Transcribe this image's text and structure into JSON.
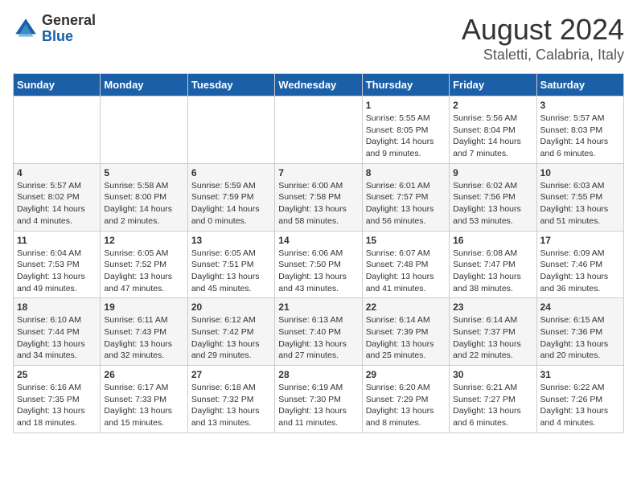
{
  "header": {
    "logo_general": "General",
    "logo_blue": "Blue",
    "month": "August 2024",
    "location": "Staletti, Calabria, Italy"
  },
  "days_of_week": [
    "Sunday",
    "Monday",
    "Tuesday",
    "Wednesday",
    "Thursday",
    "Friday",
    "Saturday"
  ],
  "weeks": [
    [
      {
        "day": "",
        "info": ""
      },
      {
        "day": "",
        "info": ""
      },
      {
        "day": "",
        "info": ""
      },
      {
        "day": "",
        "info": ""
      },
      {
        "day": "1",
        "info": "Sunrise: 5:55 AM\nSunset: 8:05 PM\nDaylight: 14 hours\nand 9 minutes."
      },
      {
        "day": "2",
        "info": "Sunrise: 5:56 AM\nSunset: 8:04 PM\nDaylight: 14 hours\nand 7 minutes."
      },
      {
        "day": "3",
        "info": "Sunrise: 5:57 AM\nSunset: 8:03 PM\nDaylight: 14 hours\nand 6 minutes."
      }
    ],
    [
      {
        "day": "4",
        "info": "Sunrise: 5:57 AM\nSunset: 8:02 PM\nDaylight: 14 hours\nand 4 minutes."
      },
      {
        "day": "5",
        "info": "Sunrise: 5:58 AM\nSunset: 8:00 PM\nDaylight: 14 hours\nand 2 minutes."
      },
      {
        "day": "6",
        "info": "Sunrise: 5:59 AM\nSunset: 7:59 PM\nDaylight: 14 hours\nand 0 minutes."
      },
      {
        "day": "7",
        "info": "Sunrise: 6:00 AM\nSunset: 7:58 PM\nDaylight: 13 hours\nand 58 minutes."
      },
      {
        "day": "8",
        "info": "Sunrise: 6:01 AM\nSunset: 7:57 PM\nDaylight: 13 hours\nand 56 minutes."
      },
      {
        "day": "9",
        "info": "Sunrise: 6:02 AM\nSunset: 7:56 PM\nDaylight: 13 hours\nand 53 minutes."
      },
      {
        "day": "10",
        "info": "Sunrise: 6:03 AM\nSunset: 7:55 PM\nDaylight: 13 hours\nand 51 minutes."
      }
    ],
    [
      {
        "day": "11",
        "info": "Sunrise: 6:04 AM\nSunset: 7:53 PM\nDaylight: 13 hours\nand 49 minutes."
      },
      {
        "day": "12",
        "info": "Sunrise: 6:05 AM\nSunset: 7:52 PM\nDaylight: 13 hours\nand 47 minutes."
      },
      {
        "day": "13",
        "info": "Sunrise: 6:05 AM\nSunset: 7:51 PM\nDaylight: 13 hours\nand 45 minutes."
      },
      {
        "day": "14",
        "info": "Sunrise: 6:06 AM\nSunset: 7:50 PM\nDaylight: 13 hours\nand 43 minutes."
      },
      {
        "day": "15",
        "info": "Sunrise: 6:07 AM\nSunset: 7:48 PM\nDaylight: 13 hours\nand 41 minutes."
      },
      {
        "day": "16",
        "info": "Sunrise: 6:08 AM\nSunset: 7:47 PM\nDaylight: 13 hours\nand 38 minutes."
      },
      {
        "day": "17",
        "info": "Sunrise: 6:09 AM\nSunset: 7:46 PM\nDaylight: 13 hours\nand 36 minutes."
      }
    ],
    [
      {
        "day": "18",
        "info": "Sunrise: 6:10 AM\nSunset: 7:44 PM\nDaylight: 13 hours\nand 34 minutes."
      },
      {
        "day": "19",
        "info": "Sunrise: 6:11 AM\nSunset: 7:43 PM\nDaylight: 13 hours\nand 32 minutes."
      },
      {
        "day": "20",
        "info": "Sunrise: 6:12 AM\nSunset: 7:42 PM\nDaylight: 13 hours\nand 29 minutes."
      },
      {
        "day": "21",
        "info": "Sunrise: 6:13 AM\nSunset: 7:40 PM\nDaylight: 13 hours\nand 27 minutes."
      },
      {
        "day": "22",
        "info": "Sunrise: 6:14 AM\nSunset: 7:39 PM\nDaylight: 13 hours\nand 25 minutes."
      },
      {
        "day": "23",
        "info": "Sunrise: 6:14 AM\nSunset: 7:37 PM\nDaylight: 13 hours\nand 22 minutes."
      },
      {
        "day": "24",
        "info": "Sunrise: 6:15 AM\nSunset: 7:36 PM\nDaylight: 13 hours\nand 20 minutes."
      }
    ],
    [
      {
        "day": "25",
        "info": "Sunrise: 6:16 AM\nSunset: 7:35 PM\nDaylight: 13 hours\nand 18 minutes."
      },
      {
        "day": "26",
        "info": "Sunrise: 6:17 AM\nSunset: 7:33 PM\nDaylight: 13 hours\nand 15 minutes."
      },
      {
        "day": "27",
        "info": "Sunrise: 6:18 AM\nSunset: 7:32 PM\nDaylight: 13 hours\nand 13 minutes."
      },
      {
        "day": "28",
        "info": "Sunrise: 6:19 AM\nSunset: 7:30 PM\nDaylight: 13 hours\nand 11 minutes."
      },
      {
        "day": "29",
        "info": "Sunrise: 6:20 AM\nSunset: 7:29 PM\nDaylight: 13 hours\nand 8 minutes."
      },
      {
        "day": "30",
        "info": "Sunrise: 6:21 AM\nSunset: 7:27 PM\nDaylight: 13 hours\nand 6 minutes."
      },
      {
        "day": "31",
        "info": "Sunrise: 6:22 AM\nSunset: 7:26 PM\nDaylight: 13 hours\nand 4 minutes."
      }
    ]
  ]
}
